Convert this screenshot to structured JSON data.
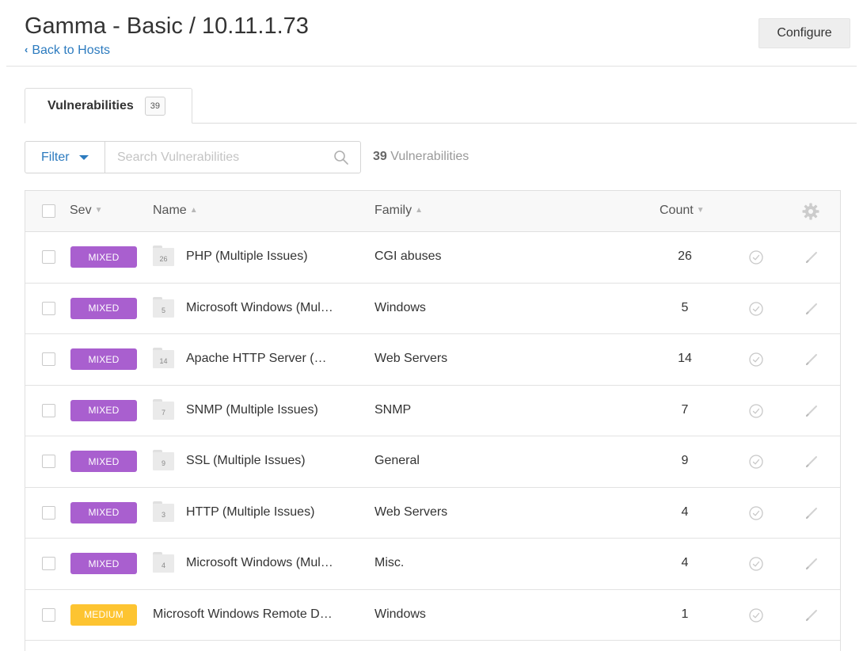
{
  "header": {
    "title": "Gamma - Basic / 10.11.1.73",
    "back_label": "Back to Hosts",
    "configure_label": "Configure"
  },
  "tabs": [
    {
      "label": "Vulnerabilities",
      "count": "39"
    }
  ],
  "toolbar": {
    "filter_label": "Filter",
    "search_placeholder": "Search Vulnerabilities",
    "summary_count": "39",
    "summary_label": "Vulnerabilities"
  },
  "table": {
    "columns": {
      "sev": "Sev",
      "name": "Name",
      "family": "Family",
      "count": "Count"
    },
    "rows": [
      {
        "severity": "MIXED",
        "grouped": true,
        "group_count": "26",
        "name": "PHP (Multiple Issues)",
        "family": "CGI abuses",
        "count": "26"
      },
      {
        "severity": "MIXED",
        "grouped": true,
        "group_count": "5",
        "name": "Microsoft Windows (Mul…",
        "family": "Windows",
        "count": "5"
      },
      {
        "severity": "MIXED",
        "grouped": true,
        "group_count": "14",
        "name": "Apache HTTP Server (…",
        "family": "Web Servers",
        "count": "14"
      },
      {
        "severity": "MIXED",
        "grouped": true,
        "group_count": "7",
        "name": "SNMP (Multiple Issues)",
        "family": "SNMP",
        "count": "7"
      },
      {
        "severity": "MIXED",
        "grouped": true,
        "group_count": "9",
        "name": "SSL (Multiple Issues)",
        "family": "General",
        "count": "9"
      },
      {
        "severity": "MIXED",
        "grouped": true,
        "group_count": "3",
        "name": "HTTP (Multiple Issues)",
        "family": "Web Servers",
        "count": "4"
      },
      {
        "severity": "MIXED",
        "grouped": true,
        "group_count": "4",
        "name": "Microsoft Windows (Mul…",
        "family": "Misc.",
        "count": "4"
      },
      {
        "severity": "MEDIUM",
        "grouped": false,
        "group_count": "",
        "name": "Microsoft Windows Remote D…",
        "family": "Windows",
        "count": "1"
      }
    ]
  },
  "colors": {
    "link": "#2c7bbf",
    "mixed": "#a95fcf",
    "medium": "#fdc431"
  },
  "icons": {
    "search": "search-icon",
    "gear": "gear-icon",
    "snooze": "snooze-icon",
    "edit": "pencil-icon",
    "folder": "folder-icon"
  }
}
